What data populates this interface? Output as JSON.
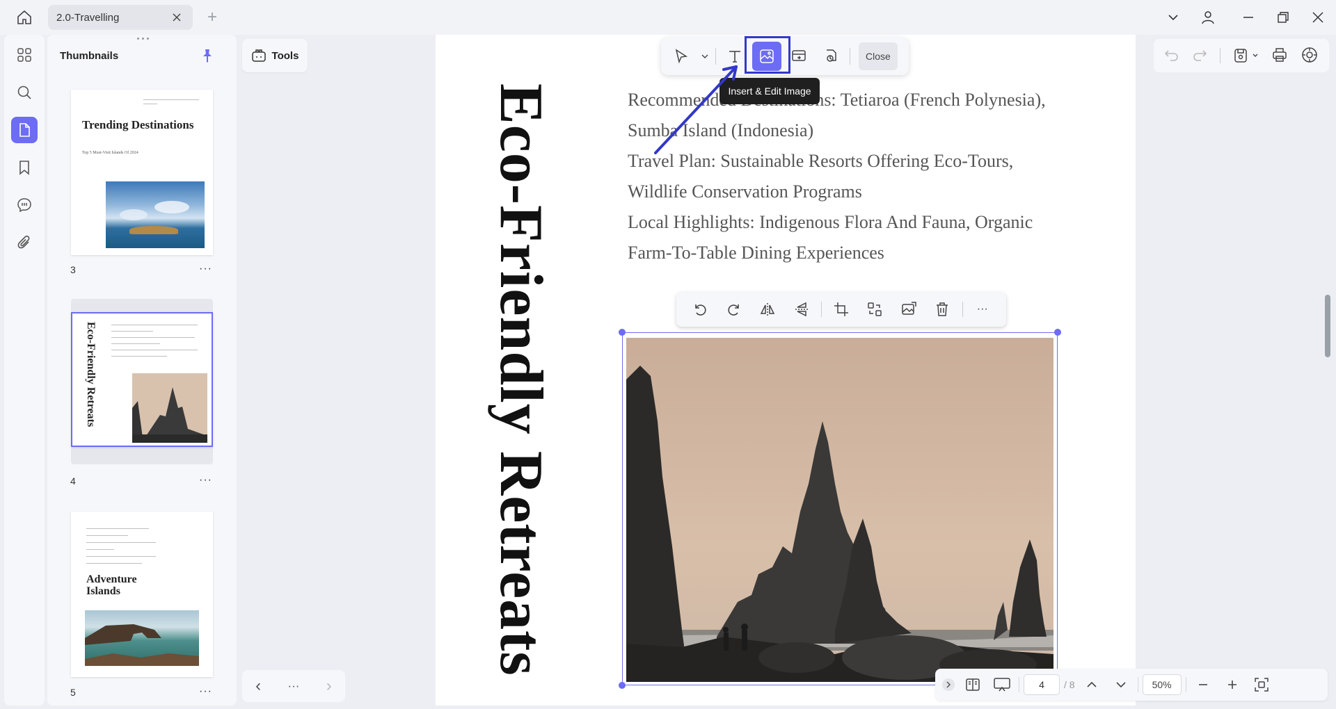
{
  "titlebar": {
    "tab_title": "2.0-Travelling"
  },
  "sidebar": {
    "items": [
      "thumbnails",
      "search",
      "pages",
      "bookmarks",
      "comments",
      "attachments"
    ]
  },
  "thumbnails": {
    "title": "Thumbnails",
    "pages": [
      {
        "num": "3",
        "heading": "Trending Destinations",
        "sub": "Top 5 Must-Visit Islands Of 2024"
      },
      {
        "num": "4",
        "heading": "Eco-Friendly Retreats"
      },
      {
        "num": "5",
        "heading": "Adventure Islands"
      }
    ],
    "more_label": "···"
  },
  "tools": {
    "label": "Tools"
  },
  "left_pager": {
    "prev": "‹",
    "more": "···",
    "next": "›"
  },
  "document": {
    "vertical_title": "Eco-Friendly Retreats",
    "lines": [
      "Recommended Destinations: Tetiaroa (French Polynesia),",
      "Sumba Island (Indonesia)",
      "Travel Plan: Sustainable Resorts Offering Eco-Tours,",
      "Wildlife Conservation Programs",
      "Local Highlights: Indigenous Flora And Fauna, Organic",
      "Farm-To-Table Dining Experiences"
    ]
  },
  "edit_toolbar": {
    "close_label": "Close",
    "tooltip": "Insert & Edit Image"
  },
  "image_toolbar": {
    "more_label": "···"
  },
  "bottom_bar": {
    "current_page": "4",
    "total_pages": "/ 8",
    "zoom": "50%"
  },
  "colors": {
    "accent": "#6c6cf4",
    "highlight": "#3338c9"
  }
}
